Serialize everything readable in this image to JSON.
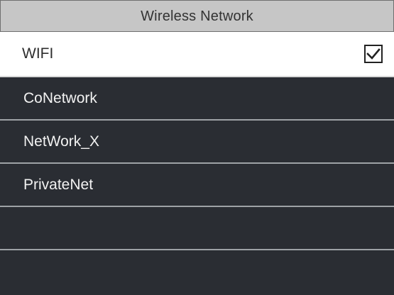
{
  "header": {
    "title": "Wireless Network"
  },
  "wifi": {
    "label": "WIFI",
    "enabled": true,
    "checkbox_icon": "checkbox-checked-icon"
  },
  "networks": [
    {
      "name": "CoNetwork"
    },
    {
      "name": "NetWork_X"
    },
    {
      "name": "PrivateNet"
    },
    {
      "name": ""
    },
    {
      "name": ""
    }
  ],
  "colors": {
    "title_background": "#c6c6c6",
    "list_background": "#2a2d33",
    "row_divider": "#9ea2a6",
    "text_light": "#f2f2f2"
  }
}
